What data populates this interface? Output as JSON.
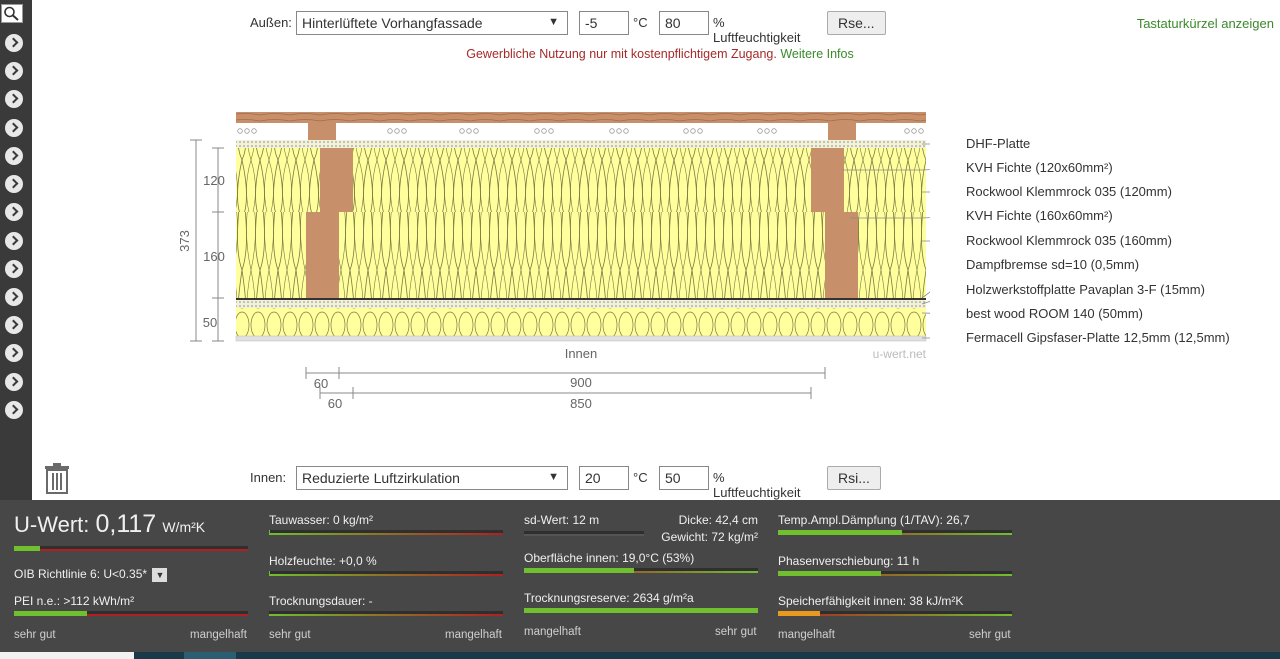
{
  "outside": {
    "label": "Außen:",
    "condition": "Hinterlüftete Vorhangfassade",
    "temp": "-5",
    "temp_unit": "°C",
    "humidity": "80",
    "humidity_unit": "% Luftfeuchtigkeit",
    "resistance_button": "Rse..."
  },
  "inside": {
    "label": "Innen:",
    "condition": "Reduzierte Luftzirkulation",
    "temp": "20",
    "temp_unit": "°C",
    "humidity": "50",
    "humidity_unit": "% Luftfeuchtigkeit",
    "resistance_button": "Rsi..."
  },
  "shortcut_link": "Tastaturkürzel anzeigen",
  "notice": {
    "text": "Gewerbliche Nutzung nur mit kostenpflichtigem Zugang.",
    "link": "Weitere Infos"
  },
  "drawing": {
    "inner_label": "Innen",
    "watermark": "u-wert.net",
    "total_thickness": "373",
    "layer_thicknesses": [
      "120",
      "160",
      "50"
    ],
    "horizontal_dims": {
      "spacing_outer": "900",
      "spacing_inner": "850",
      "width_outer": "60",
      "width_inner": "60"
    },
    "layers": [
      "DHF-Platte",
      "KVH Fichte (120x60mm²)",
      "Rockwool Klemmrock 035 (120mm)",
      "KVH Fichte (160x60mm²)",
      "Rockwool Klemmrock 035 (160mm)",
      "Dampfbremse sd=10 (0,5mm)",
      "Holzwerkstoffplatte Pavaplan 3-F (15mm)",
      "best wood ROOM 140 (50mm)",
      "Fermacell Gipsfaser-Platte 12,5mm (12,5mm)"
    ]
  },
  "results": {
    "uvalue_label": "U-Wert:",
    "uvalue": "0,117",
    "uvalue_unit": "W/m²K",
    "uvalue_fill": 0.11,
    "oib": "OIB Richtlinie 6: U<0.35*",
    "pei": "PEI n.e.: >112 kWh/m²",
    "pei_fill": 0.31,
    "tauwasser": "Tauwasser: 0 kg/m²",
    "tauwasser_fill": 0.005,
    "holzfeuchte": "Holzfeuchte: +0,0 %",
    "holzfeuchte_fill": 0.005,
    "trocknungsdauer": "Trocknungsdauer: -",
    "trocknungsdauer_fill": 0.0,
    "sd": "sd-Wert: 12 m",
    "dicke": "Dicke: 42,4 cm",
    "gewicht": "Gewicht: 72 kg/m²",
    "sd_fill": 0.0,
    "oberflaeche": "Oberfläche innen: 19,0°C (53%)",
    "oberflaeche_fill": 0.47,
    "trocknungsreserve": "Trocknungsreserve: 2634 g/m²a",
    "trocknungsreserve_fill": 1.0,
    "temp_ampl": "Temp.Ampl.Dämpfung (1/TAV): 26,7",
    "temp_ampl_fill": 0.53,
    "phasen": "Phasenverschiebung: 11 h",
    "phasen_fill": 0.44,
    "speicher": "Speicherfähigkeit innen: 38 kJ/m²K",
    "speicher_fill": 0.18,
    "scale_good": "sehr gut",
    "scale_bad": "mangelhaft"
  },
  "colors": {
    "insulation": "#ffff9e",
    "timber": "#c8906a",
    "bar_good": "#6fbf2e",
    "bar_low": "#e89a1e",
    "link_green": "#3a8a2a",
    "notice_red": "#a52a2a"
  }
}
